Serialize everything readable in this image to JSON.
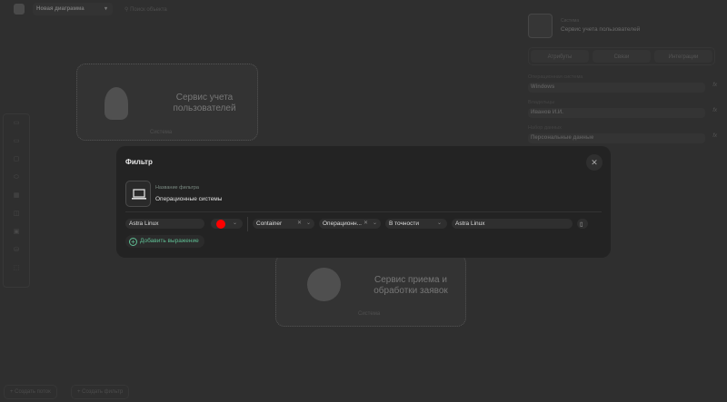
{
  "topbar": {
    "diagram_name": "Новая диаграмма",
    "search_placeholder": "Поиск объекта"
  },
  "canvas": {
    "cards": [
      {
        "title": "Сервис учета пользователей",
        "type": "Система"
      },
      {
        "title": "Сервис приема и обработки заявок",
        "type": "Система"
      }
    ]
  },
  "right_panel": {
    "type_label": "Система",
    "name": "Сервис учета пользователей",
    "tabs": [
      "Атрибуты",
      "Связи",
      "Интеграции"
    ],
    "fields": [
      {
        "label": "Операционная система",
        "value": "Windows"
      },
      {
        "label": "Владельцы",
        "value": "Иванов И.И."
      },
      {
        "label": "Набор данных",
        "value": "Персональные данные"
      }
    ],
    "fx_icon": "fx"
  },
  "bottom": {
    "create_flow": "Создать поток",
    "create_filter": "Создать фильтр"
  },
  "modal": {
    "title": "Фильтр",
    "filter_name_label": "Название фильтра",
    "filter_name": "Операционные системы",
    "expression": {
      "name": "Astra Linux",
      "color": "#ff0000",
      "object_type": "Container",
      "attribute": "Операционн...",
      "condition": "В точности",
      "value": "Astra Linux"
    },
    "add_expression": "Добавить выражение"
  }
}
